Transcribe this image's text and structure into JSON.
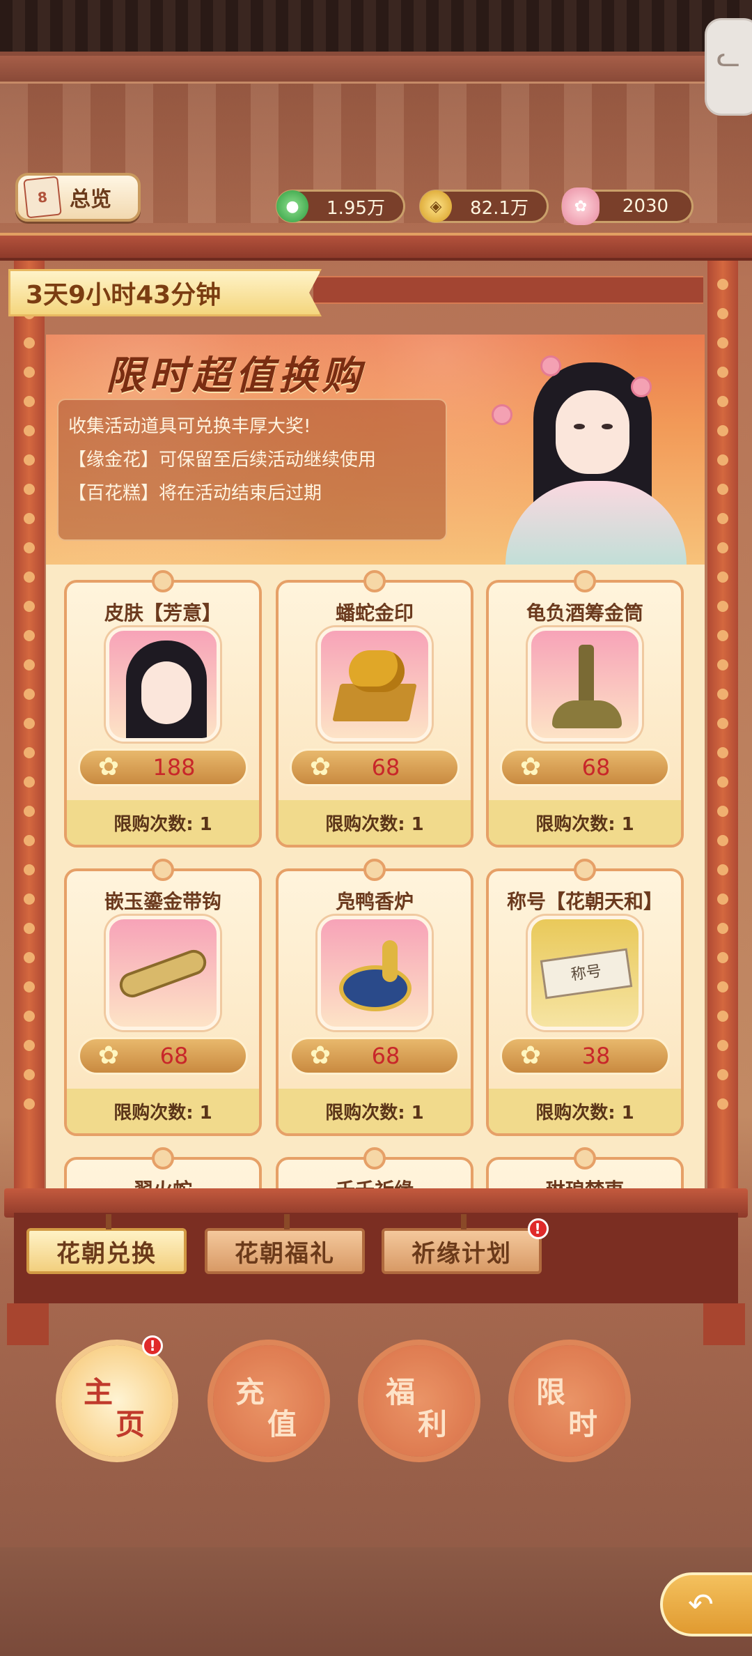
{
  "header": {
    "overview_label": "总览",
    "calendar_badge": "8",
    "currencies": [
      {
        "icon": "jade-coin-icon",
        "value": "1.95万",
        "color": "#2c9a3c"
      },
      {
        "icon": "gold-coin-icon",
        "value": "82.1万",
        "color": "#d49a20"
      },
      {
        "icon": "flower-icon",
        "value": "2030",
        "color": "#e78aa0"
      }
    ]
  },
  "timer": "3天9小时43分钟",
  "banner": {
    "title": "限时超值换购",
    "lines": [
      "收集活动道具可兑换丰厚大奖!",
      "【缘金花】可保留至后续活动继续使用",
      "【百花糕】将在活动结束后过期"
    ]
  },
  "items": [
    {
      "name": "皮肤【芳意】",
      "price": "188",
      "limit": "限购次数: 1",
      "art": "skin-portrait"
    },
    {
      "name": "蟠蛇金印",
      "price": "68",
      "limit": "限购次数: 1",
      "art": "gold-seal"
    },
    {
      "name": "龟负酒筹金筒",
      "price": "68",
      "limit": "限购次数: 1",
      "art": "turtle-tube"
    },
    {
      "name": "嵌玉鎏金带钩",
      "price": "68",
      "limit": "限购次数: 1",
      "art": "belt-hook"
    },
    {
      "name": "凫鸭香炉",
      "price": "68",
      "limit": "限购次数: 1",
      "art": "duck-censer"
    },
    {
      "name": "称号【花朝天和】",
      "price": "38",
      "limit": "限购次数: 1",
      "art": "title-tag",
      "tag_text": "称号"
    },
    {
      "name": "翟火蛇"
    },
    {
      "name": "千千祈缘"
    },
    {
      "name": "琳琅梦東"
    }
  ],
  "tabs": [
    {
      "label": "花朝兑换",
      "active": true
    },
    {
      "label": "花朝福礼",
      "active": false
    },
    {
      "label": "祈缘计划",
      "active": false,
      "badge": "!"
    }
  ],
  "nav": [
    {
      "line1": "主",
      "line2": "页",
      "active": true,
      "badge": "!"
    },
    {
      "line1": "充",
      "line2": "值",
      "active": false
    },
    {
      "line1": "福",
      "line2": "利",
      "active": false
    },
    {
      "line1": "限",
      "line2": "时",
      "active": false
    }
  ]
}
